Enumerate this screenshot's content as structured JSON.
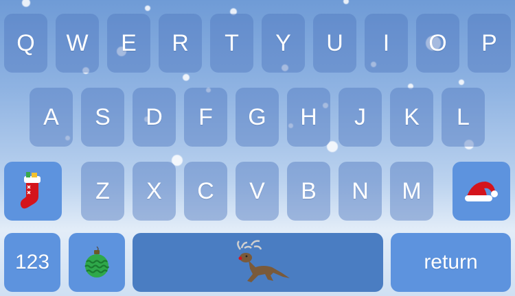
{
  "keyboard": {
    "rows": [
      [
        "Q",
        "W",
        "E",
        "R",
        "T",
        "Y",
        "U",
        "I",
        "O",
        "P"
      ],
      [
        "A",
        "S",
        "D",
        "F",
        "G",
        "H",
        "J",
        "K",
        "L"
      ],
      [
        "Z",
        "X",
        "C",
        "V",
        "B",
        "N",
        "M"
      ]
    ],
    "numbers_label": "123",
    "return_label": "return",
    "icons": {
      "left_special": "stocking-icon",
      "right_special": "santa-hat-icon",
      "ornament": "ornament-icon",
      "space": "reindeer-icon"
    }
  }
}
